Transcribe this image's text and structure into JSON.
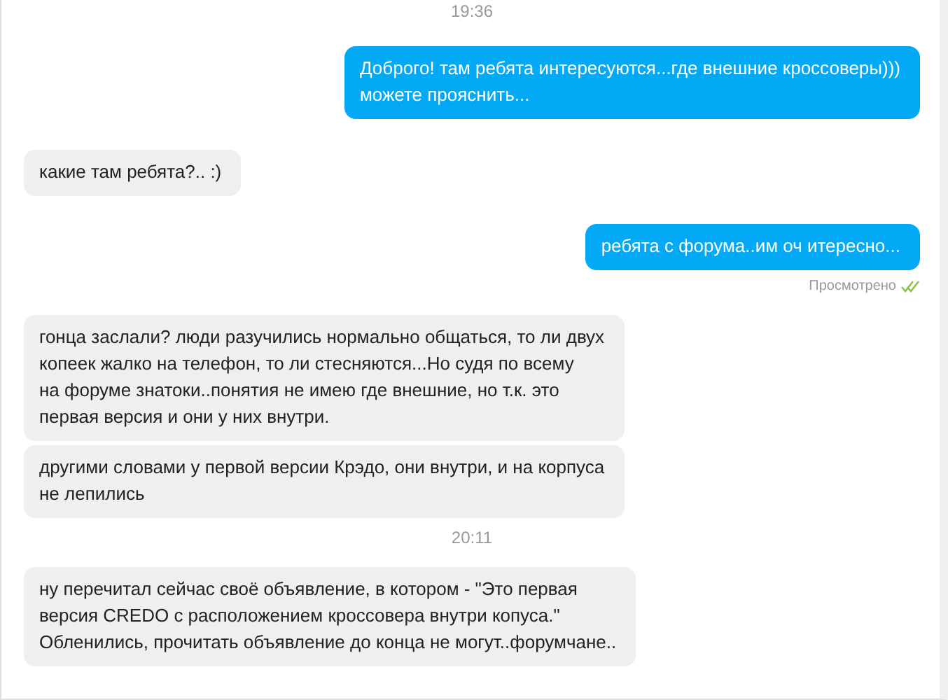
{
  "messages": [
    {
      "kind": "time",
      "text": "19:36"
    },
    {
      "kind": "outgoing",
      "text": "Доброго! там ребята интересуются...где внешние кроссоверы)))\nможете прояснить..."
    },
    {
      "kind": "incoming",
      "text": "какие там ребята?.. :)"
    },
    {
      "kind": "outgoing",
      "text": "ребята с форума..им оч итересно..."
    },
    {
      "kind": "seen",
      "text": "Просмотрено"
    },
    {
      "kind": "incoming",
      "text": "гонца заслали? люди разучились нормально общаться, то ли двух\nкопеек жалко на телефон, то ли стесняются...Но судя по всему\n на форуме знатоки..понятия не имею где внешние, но т.к. это\nпервая версия и они у них внутри."
    },
    {
      "kind": "incoming",
      "text": "другими словами у первой версии Крэдо, они внутри, и на корпуса\nне лепились"
    },
    {
      "kind": "time",
      "text": "20:11"
    },
    {
      "kind": "incoming",
      "text": "ну перечитал сейчас своё объявление, в котором - \"Это первая\nверсия CREDO с расположением кроссовера внутри копуса.\"\nОбленились, прочитать объявление до конца не могут..форумчане.."
    }
  ]
}
